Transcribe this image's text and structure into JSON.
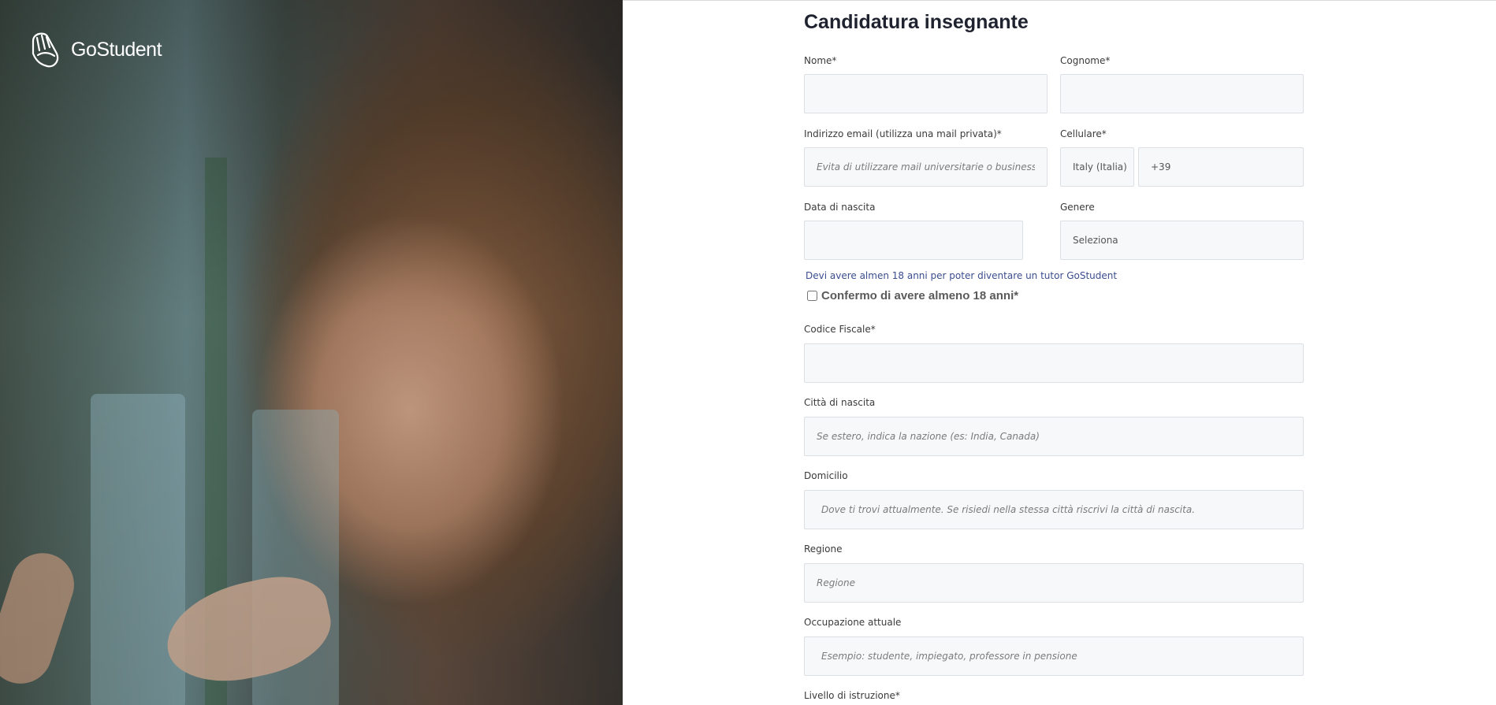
{
  "brand": {
    "name": "GoStudent"
  },
  "form": {
    "title": "Candidatura insegnante",
    "fields": {
      "first_name": {
        "label": "Nome*",
        "value": ""
      },
      "last_name": {
        "label": "Cognome*",
        "value": ""
      },
      "email": {
        "label": "Indirizzo email (utilizza una mail privata)*",
        "placeholder": "Evita di utilizzare mail universitarie o business"
      },
      "phone": {
        "label": "Cellulare*",
        "country": "Italy (Italia)",
        "prefix": "+39"
      },
      "birth_date": {
        "label": "Data di nascita",
        "value": ""
      },
      "gender": {
        "label": "Genere",
        "selected": "Seleziona"
      },
      "tax_code": {
        "label": "Codice Fiscale*",
        "value": ""
      },
      "birth_city": {
        "label": "Città di nascita",
        "placeholder": "Se estero, indica la nazione (es: India, Canada)"
      },
      "residence": {
        "label": "Domicilio",
        "placeholder": "Dove ti trovi attualmente. Se risiedi nella stessa città riscrivi la città di nascita."
      },
      "region": {
        "label": "Regione",
        "placeholder": "Regione"
      },
      "occupation": {
        "label": "Occupazione attuale",
        "placeholder": "Esempio: studente, impiegato, professore in pensione"
      },
      "education": {
        "label": "Livello di istruzione*"
      }
    },
    "age_hint": "Devi avere almen 18 anni per poter diventare un tutor GoStudent",
    "age_confirm_label": "Confermo di avere almeno 18 anni*"
  }
}
